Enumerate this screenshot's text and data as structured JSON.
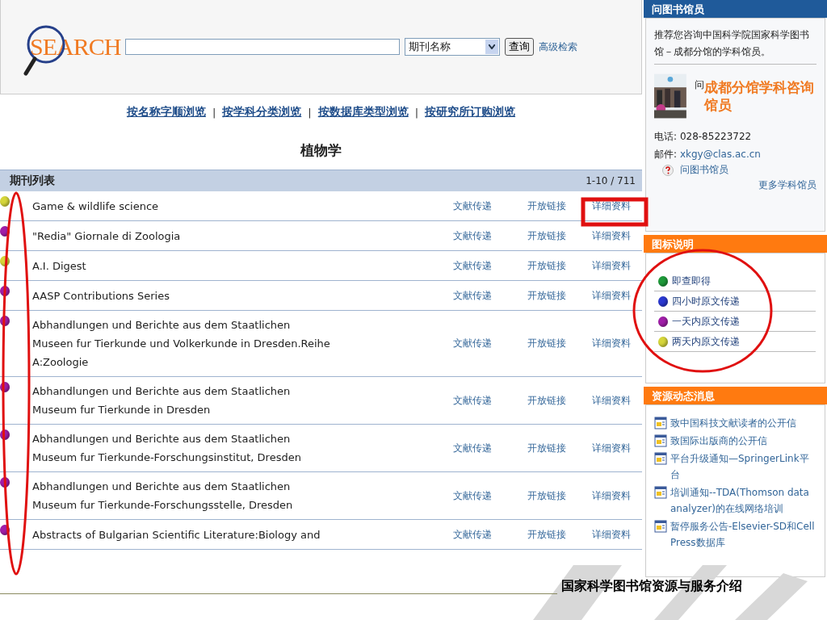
{
  "search": {
    "logo": "SEARCH",
    "dropdown": "期刊名称",
    "button": "查询",
    "advanced_link": "高级检索"
  },
  "browse_links": [
    "按名称字顺浏览",
    "按学科分类浏览",
    "按数据库类型浏览",
    "按研究所订购浏览"
  ],
  "browse_separators": [
    "|",
    "|",
    "|"
  ],
  "subject_title": "植物学",
  "journal_list": {
    "title": "期刊列表",
    "range": "1-10 / 711",
    "rows": [
      {
        "title": "Game & wildlife science",
        "color": "#d6d63a",
        "links": [
          "文献传递",
          "开放链接",
          "详细资料"
        ]
      },
      {
        "title": "\"Redia\" Giornale di Zoologia",
        "color": "#a01ea8",
        "links": [
          "文献传递",
          "开放链接",
          "详细资料"
        ]
      },
      {
        "title": "A.I. Digest",
        "color": "#d6d63a",
        "links": [
          "文献传递",
          "开放链接",
          "详细资料"
        ]
      },
      {
        "title": "AASP Contributions Series",
        "color": "#a01ea8",
        "links": [
          "文献传递",
          "开放链接",
          "详细资料"
        ]
      },
      {
        "title": "Abhandlungen und Berichte aus dem Staatlichen\nMuseen fur Tierkunde und Volkerkunde in Dresden.Reihe\nA:Zoologie",
        "color": "#a01ea8",
        "links": [
          "文献传递",
          "开放链接",
          "详细资料"
        ]
      },
      {
        "title": "Abhandlungen und Berichte aus dem Staatlichen\nMuseum fur Tierkunde in Dresden",
        "color": "#a01ea8",
        "links": [
          "文献传递",
          "开放链接",
          "详细资料"
        ]
      },
      {
        "title": "Abhandlungen und Berichte aus dem Staatlichen\nMuseum fur Tierkunde-Forschungsinstitut, Dresden",
        "color": "#a01ea8",
        "links": [
          "文献传递",
          "开放链接",
          "详细资料"
        ]
      },
      {
        "title": "Abhandlungen und Berichte aus dem Staatlichen\nMuseum fur Tierkunde-Forschungsstelle, Dresden",
        "color": "#a01ea8",
        "links": [
          "文献传递",
          "开放链接",
          "详细资料"
        ]
      },
      {
        "title": "Abstracts of Bulgarian Scientific Literature:Biology and",
        "color": "#a01ea8",
        "links": [
          "文献传递",
          "开放链接",
          "详细资料"
        ]
      }
    ]
  },
  "ask_librarian": {
    "title": "问图书馆员",
    "intro": "推荐您咨询中国科学院国家科学图书馆－成都分馆的学科馆员。",
    "prefix": "问",
    "headline": "成都分馆学科咨询馆员",
    "phone_label": "电话:",
    "phone": "028-85223722",
    "email_label": "邮件:",
    "email": "xkgy@clas.ac.cn",
    "ask_link": "问图书馆员",
    "more_link": "更多学科馆员"
  },
  "legend": {
    "title": "图标说明",
    "items": [
      {
        "label": "即查即得",
        "color": "#1e9a3a"
      },
      {
        "label": "四小时原文传递",
        "color": "#2a38d0"
      },
      {
        "label": "一天内原文传递",
        "color": "#a01ea8"
      },
      {
        "label": "两天内原文传递",
        "color": "#d6d63a"
      }
    ]
  },
  "news": {
    "title": "资源动态消息",
    "items": [
      "致中国科技文献读者的公开信",
      "致国际出版商的公开信",
      "平台升级通知—SpringerLink平台",
      "培训通知--TDA(Thomson data analyzer)的在线网络培训",
      "暂停服务公告-Elsevier-SD和Cell Press数据库"
    ]
  },
  "footer": "国家科学图书馆资源与服务介绍"
}
